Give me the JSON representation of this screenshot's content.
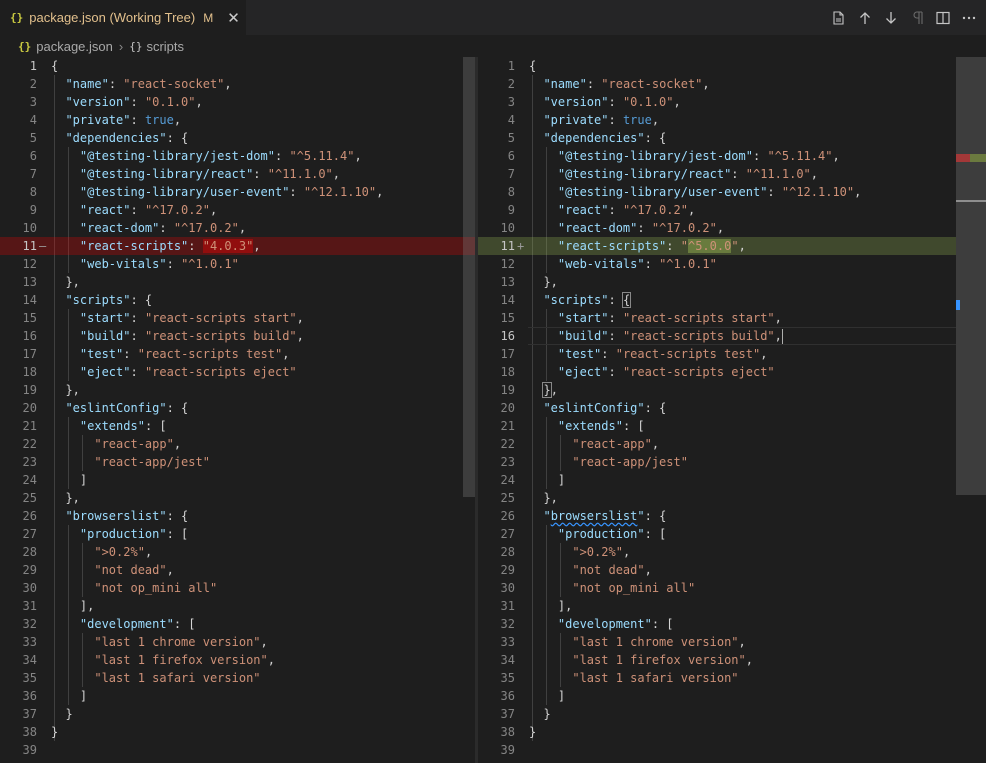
{
  "tab": {
    "icon_label": "{}",
    "title": "package.json (Working Tree)",
    "badge": "M",
    "close_glyph": "✕"
  },
  "toolbar": {
    "icons": [
      "open-file-icon",
      "previous-change-icon",
      "next-change-icon",
      "show-whitespace-icon",
      "split-editor-icon",
      "more-actions-icon"
    ]
  },
  "breadcrumb": {
    "file_icon": "{}",
    "file": "package.json",
    "separator": "›",
    "symbol_icon": "{}",
    "symbol": "scripts"
  },
  "colors": {
    "removed": "#5a1d1d",
    "added": "#4b5632",
    "key": "#9cdcfe",
    "string": "#ce9178",
    "boolean": "#569cd6"
  },
  "left": {
    "line_numbers": [
      "1",
      "2",
      "3",
      "4",
      "5",
      "6",
      "7",
      "8",
      "9",
      "10",
      "11",
      "12",
      "13",
      "14",
      "15",
      "16",
      "17",
      "18",
      "19",
      "20",
      "21",
      "22",
      "23",
      "24",
      "25",
      "26",
      "27",
      "28",
      "29",
      "30",
      "31",
      "32",
      "33",
      "34",
      "35",
      "36",
      "37",
      "38",
      "39"
    ],
    "removed_marker": "—",
    "changed_value": "\"4.0.3\""
  },
  "right": {
    "line_numbers": [
      "1",
      "2",
      "3",
      "4",
      "5",
      "6",
      "7",
      "8",
      "9",
      "10",
      "11",
      "12",
      "13",
      "14",
      "15",
      "16",
      "17",
      "18",
      "19",
      "20",
      "21",
      "22",
      "23",
      "24",
      "25",
      "26",
      "27",
      "28",
      "29",
      "30",
      "31",
      "32",
      "33",
      "34",
      "35",
      "36",
      "37",
      "38",
      "39"
    ],
    "added_marker": "+",
    "changed_value_prefix": "\"",
    "changed_value_highlight": "^5.0.0",
    "changed_value_suffix": "\""
  },
  "code": {
    "open": "{",
    "name_key": "\"name\"",
    "name_val": "\"react-socket\"",
    "version_key": "\"version\"",
    "version_val": "\"0.1.0\"",
    "private_key": "\"private\"",
    "private_val": "true",
    "deps_key": "\"dependencies\"",
    "jestdom_key": "\"@testing-library/jest-dom\"",
    "jestdom_val": "\"^5.11.4\"",
    "tlreact_key": "\"@testing-library/react\"",
    "tlreact_val": "\"^11.1.0\"",
    "userevent_key": "\"@testing-library/user-event\"",
    "userevent_val": "\"^12.1.10\"",
    "react_key": "\"react\"",
    "react_val": "\"^17.0.2\"",
    "reactdom_key": "\"react-dom\"",
    "reactdom_val": "\"^17.0.2\"",
    "rs_key": "\"react-scripts\"",
    "webvitals_key": "\"web-vitals\"",
    "webvitals_val": "\"^1.0.1\"",
    "scripts_key": "\"scripts\"",
    "start_key": "\"start\"",
    "start_val": "\"react-scripts start\"",
    "build_key": "\"build\"",
    "build_val": "\"react-scripts build\"",
    "test_key": "\"test\"",
    "test_val": "\"react-scripts test\"",
    "eject_key": "\"eject\"",
    "eject_val": "\"react-scripts eject\"",
    "eslint_key": "\"eslintConfig\"",
    "extends_key": "\"extends\"",
    "ra_val": "\"react-app\"",
    "raj_val": "\"react-app/jest\"",
    "browsers_key": "\"browserslist\"",
    "browsers_word": "browserslist",
    "prod_key": "\"production\"",
    "p1": "\">0.2%\"",
    "p2": "\"not dead\"",
    "p3": "\"not op_mini all\"",
    "dev_key": "\"development\"",
    "d1": "\"last 1 chrome version\"",
    "d2": "\"last 1 firefox version\"",
    "d3": "\"last 1 safari version\""
  }
}
